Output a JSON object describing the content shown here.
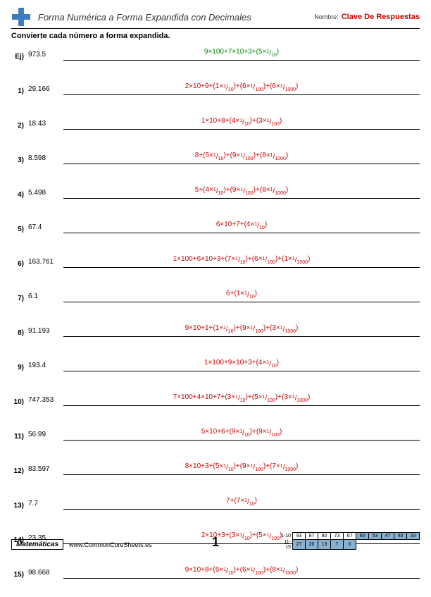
{
  "header": {
    "title": "Forma Numérica a Forma Expandida con Decimales",
    "name_label": "Nombre:",
    "answer_key": "Clave De Respuestas"
  },
  "instruction": "Convierte cada número a forma expandida.",
  "problems": [
    {
      "n": "Ej)",
      "q": "973.5",
      "a": [
        {
          "t": "9×100+7×10+3+(5×"
        },
        {
          "f": [
            "1",
            "10"
          ]
        },
        {
          "t": ")"
        }
      ],
      "ex": true
    },
    {
      "n": "1)",
      "q": "29.166",
      "a": [
        {
          "t": "2×10+9+(1×"
        },
        {
          "f": [
            "1",
            "10"
          ]
        },
        {
          "t": ")+(6×"
        },
        {
          "f": [
            "1",
            "100"
          ]
        },
        {
          "t": ")+(6×"
        },
        {
          "f": [
            "1",
            "1000"
          ]
        },
        {
          "t": ")"
        }
      ]
    },
    {
      "n": "2)",
      "q": "18.43",
      "a": [
        {
          "t": "1×10+8+(4×"
        },
        {
          "f": [
            "1",
            "10"
          ]
        },
        {
          "t": ")+(3×"
        },
        {
          "f": [
            "1",
            "100"
          ]
        },
        {
          "t": ")"
        }
      ]
    },
    {
      "n": "3)",
      "q": "8.598",
      "a": [
        {
          "t": "8+(5×"
        },
        {
          "f": [
            "1",
            "10"
          ]
        },
        {
          "t": ")+(9×"
        },
        {
          "f": [
            "1",
            "100"
          ]
        },
        {
          "t": ")+(8×"
        },
        {
          "f": [
            "1",
            "1000"
          ]
        },
        {
          "t": ")"
        }
      ]
    },
    {
      "n": "4)",
      "q": "5.498",
      "a": [
        {
          "t": "5+(4×"
        },
        {
          "f": [
            "1",
            "10"
          ]
        },
        {
          "t": ")+(9×"
        },
        {
          "f": [
            "1",
            "100"
          ]
        },
        {
          "t": ")+(8×"
        },
        {
          "f": [
            "1",
            "1000"
          ]
        },
        {
          "t": ")"
        }
      ]
    },
    {
      "n": "5)",
      "q": "67.4",
      "a": [
        {
          "t": "6×10+7+(4×"
        },
        {
          "f": [
            "1",
            "10"
          ]
        },
        {
          "t": ")"
        }
      ]
    },
    {
      "n": "6)",
      "q": "163.761",
      "a": [
        {
          "t": "1×100+6×10+3+(7×"
        },
        {
          "f": [
            "1",
            "10"
          ]
        },
        {
          "t": ")+(6×"
        },
        {
          "f": [
            "1",
            "100"
          ]
        },
        {
          "t": ")+(1×"
        },
        {
          "f": [
            "1",
            "1000"
          ]
        },
        {
          "t": ")"
        }
      ]
    },
    {
      "n": "7)",
      "q": "6.1",
      "a": [
        {
          "t": "6+(1×"
        },
        {
          "f": [
            "1",
            "10"
          ]
        },
        {
          "t": ")"
        }
      ]
    },
    {
      "n": "8)",
      "q": "91.193",
      "a": [
        {
          "t": "9×10+1+(1×"
        },
        {
          "f": [
            "1",
            "10"
          ]
        },
        {
          "t": ")+(9×"
        },
        {
          "f": [
            "1",
            "100"
          ]
        },
        {
          "t": ")+(3×"
        },
        {
          "f": [
            "1",
            "1000"
          ]
        },
        {
          "t": ")"
        }
      ]
    },
    {
      "n": "9)",
      "q": "193.4",
      "a": [
        {
          "t": "1×100+9×10+3+(4×"
        },
        {
          "f": [
            "1",
            "10"
          ]
        },
        {
          "t": ")"
        }
      ]
    },
    {
      "n": "10)",
      "q": "747.353",
      "a": [
        {
          "t": "7×100+4×10+7+(3×"
        },
        {
          "f": [
            "1",
            "10"
          ]
        },
        {
          "t": ")+(5×"
        },
        {
          "f": [
            "1",
            "100"
          ]
        },
        {
          "t": ")+(3×"
        },
        {
          "f": [
            "1",
            "1000"
          ]
        },
        {
          "t": ")"
        }
      ]
    },
    {
      "n": "11)",
      "q": "56.99",
      "a": [
        {
          "t": "5×10+6+(9×"
        },
        {
          "f": [
            "1",
            "10"
          ]
        },
        {
          "t": ")+(9×"
        },
        {
          "f": [
            "1",
            "100"
          ]
        },
        {
          "t": ")"
        }
      ]
    },
    {
      "n": "12)",
      "q": "83.597",
      "a": [
        {
          "t": "8×10+3+(5×"
        },
        {
          "f": [
            "1",
            "10"
          ]
        },
        {
          "t": ")+(9×"
        },
        {
          "f": [
            "1",
            "100"
          ]
        },
        {
          "t": ")+(7×"
        },
        {
          "f": [
            "1",
            "1000"
          ]
        },
        {
          "t": ")"
        }
      ]
    },
    {
      "n": "13)",
      "q": "7.7",
      "a": [
        {
          "t": "7+(7×"
        },
        {
          "f": [
            "1",
            "10"
          ]
        },
        {
          "t": ")"
        }
      ]
    },
    {
      "n": "14)",
      "q": "23.35",
      "a": [
        {
          "t": "2×10+3+(3×"
        },
        {
          "f": [
            "1",
            "10"
          ]
        },
        {
          "t": ")+(5×"
        },
        {
          "f": [
            "1",
            "100"
          ]
        },
        {
          "t": ")"
        }
      ]
    },
    {
      "n": "15)",
      "q": "98.668",
      "a": [
        {
          "t": "9×10+8+(6×"
        },
        {
          "f": [
            "1",
            "10"
          ]
        },
        {
          "t": ")+(6×"
        },
        {
          "f": [
            "1",
            "100"
          ]
        },
        {
          "t": ")+(8×"
        },
        {
          "f": [
            "1",
            "1000"
          ]
        },
        {
          "t": ")"
        }
      ]
    }
  ],
  "footer": {
    "subject": "Matemáticas",
    "url": "www.CommonCoreSheets.es",
    "page": "1",
    "score": {
      "row1_label": "1-10",
      "row2_label": "11-15",
      "row1": [
        "93",
        "87",
        "80",
        "73",
        "67",
        "60",
        "53",
        "47",
        "40",
        "33"
      ],
      "row2": [
        "27",
        "20",
        "13",
        "7",
        "0"
      ],
      "shade_start_row1": 5,
      "shade_all_row2": true
    }
  }
}
